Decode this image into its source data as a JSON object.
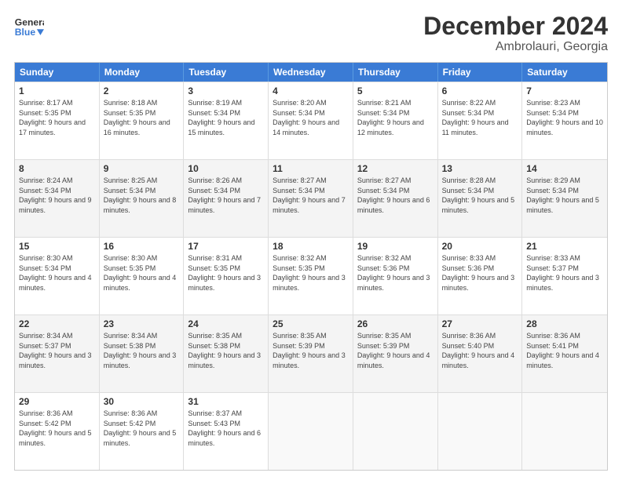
{
  "header": {
    "logo_line1": "General",
    "logo_line2": "Blue",
    "title": "December 2024",
    "subtitle": "Ambrolauri, Georgia"
  },
  "days_of_week": [
    "Sunday",
    "Monday",
    "Tuesday",
    "Wednesday",
    "Thursday",
    "Friday",
    "Saturday"
  ],
  "weeks": [
    [
      {
        "day": "1",
        "sunrise": "8:17 AM",
        "sunset": "5:35 PM",
        "daylight": "9 hours and 17 minutes."
      },
      {
        "day": "2",
        "sunrise": "8:18 AM",
        "sunset": "5:35 PM",
        "daylight": "9 hours and 16 minutes."
      },
      {
        "day": "3",
        "sunrise": "8:19 AM",
        "sunset": "5:34 PM",
        "daylight": "9 hours and 15 minutes."
      },
      {
        "day": "4",
        "sunrise": "8:20 AM",
        "sunset": "5:34 PM",
        "daylight": "9 hours and 14 minutes."
      },
      {
        "day": "5",
        "sunrise": "8:21 AM",
        "sunset": "5:34 PM",
        "daylight": "9 hours and 12 minutes."
      },
      {
        "day": "6",
        "sunrise": "8:22 AM",
        "sunset": "5:34 PM",
        "daylight": "9 hours and 11 minutes."
      },
      {
        "day": "7",
        "sunrise": "8:23 AM",
        "sunset": "5:34 PM",
        "daylight": "9 hours and 10 minutes."
      }
    ],
    [
      {
        "day": "8",
        "sunrise": "8:24 AM",
        "sunset": "5:34 PM",
        "daylight": "9 hours and 9 minutes."
      },
      {
        "day": "9",
        "sunrise": "8:25 AM",
        "sunset": "5:34 PM",
        "daylight": "9 hours and 8 minutes."
      },
      {
        "day": "10",
        "sunrise": "8:26 AM",
        "sunset": "5:34 PM",
        "daylight": "9 hours and 7 minutes."
      },
      {
        "day": "11",
        "sunrise": "8:27 AM",
        "sunset": "5:34 PM",
        "daylight": "9 hours and 7 minutes."
      },
      {
        "day": "12",
        "sunrise": "8:27 AM",
        "sunset": "5:34 PM",
        "daylight": "9 hours and 6 minutes."
      },
      {
        "day": "13",
        "sunrise": "8:28 AM",
        "sunset": "5:34 PM",
        "daylight": "9 hours and 5 minutes."
      },
      {
        "day": "14",
        "sunrise": "8:29 AM",
        "sunset": "5:34 PM",
        "daylight": "9 hours and 5 minutes."
      }
    ],
    [
      {
        "day": "15",
        "sunrise": "8:30 AM",
        "sunset": "5:34 PM",
        "daylight": "9 hours and 4 minutes."
      },
      {
        "day": "16",
        "sunrise": "8:30 AM",
        "sunset": "5:35 PM",
        "daylight": "9 hours and 4 minutes."
      },
      {
        "day": "17",
        "sunrise": "8:31 AM",
        "sunset": "5:35 PM",
        "daylight": "9 hours and 3 minutes."
      },
      {
        "day": "18",
        "sunrise": "8:32 AM",
        "sunset": "5:35 PM",
        "daylight": "9 hours and 3 minutes."
      },
      {
        "day": "19",
        "sunrise": "8:32 AM",
        "sunset": "5:36 PM",
        "daylight": "9 hours and 3 minutes."
      },
      {
        "day": "20",
        "sunrise": "8:33 AM",
        "sunset": "5:36 PM",
        "daylight": "9 hours and 3 minutes."
      },
      {
        "day": "21",
        "sunrise": "8:33 AM",
        "sunset": "5:37 PM",
        "daylight": "9 hours and 3 minutes."
      }
    ],
    [
      {
        "day": "22",
        "sunrise": "8:34 AM",
        "sunset": "5:37 PM",
        "daylight": "9 hours and 3 minutes."
      },
      {
        "day": "23",
        "sunrise": "8:34 AM",
        "sunset": "5:38 PM",
        "daylight": "9 hours and 3 minutes."
      },
      {
        "day": "24",
        "sunrise": "8:35 AM",
        "sunset": "5:38 PM",
        "daylight": "9 hours and 3 minutes."
      },
      {
        "day": "25",
        "sunrise": "8:35 AM",
        "sunset": "5:39 PM",
        "daylight": "9 hours and 3 minutes."
      },
      {
        "day": "26",
        "sunrise": "8:35 AM",
        "sunset": "5:39 PM",
        "daylight": "9 hours and 4 minutes."
      },
      {
        "day": "27",
        "sunrise": "8:36 AM",
        "sunset": "5:40 PM",
        "daylight": "9 hours and 4 minutes."
      },
      {
        "day": "28",
        "sunrise": "8:36 AM",
        "sunset": "5:41 PM",
        "daylight": "9 hours and 4 minutes."
      }
    ],
    [
      {
        "day": "29",
        "sunrise": "8:36 AM",
        "sunset": "5:42 PM",
        "daylight": "9 hours and 5 minutes."
      },
      {
        "day": "30",
        "sunrise": "8:36 AM",
        "sunset": "5:42 PM",
        "daylight": "9 hours and 5 minutes."
      },
      {
        "day": "31",
        "sunrise": "8:37 AM",
        "sunset": "5:43 PM",
        "daylight": "9 hours and 6 minutes."
      },
      null,
      null,
      null,
      null
    ]
  ],
  "labels": {
    "sunrise": "Sunrise:",
    "sunset": "Sunset:",
    "daylight": "Daylight:"
  }
}
